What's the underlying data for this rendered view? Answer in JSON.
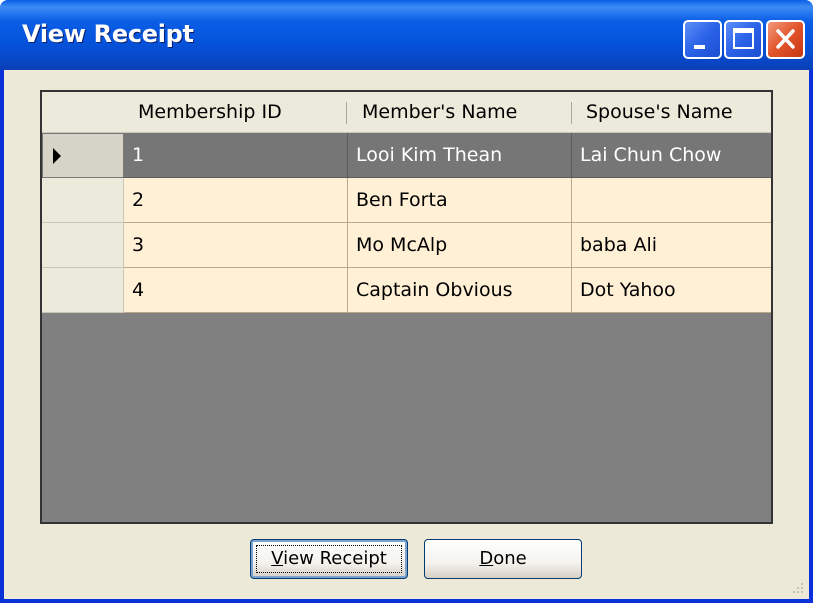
{
  "window": {
    "title": "View Receipt"
  },
  "grid": {
    "columns": [
      "Membership ID",
      "Member's Name",
      "Spouse's Name"
    ],
    "rows": [
      [
        "1",
        "Looi Kim Thean",
        "Lai Chun Chow"
      ],
      [
        "2",
        "Ben Forta",
        ""
      ],
      [
        "3",
        "Mo McAlp",
        "baba Ali"
      ],
      [
        "4",
        "Captain Obvious",
        "Dot Yahoo"
      ]
    ],
    "selected_row": 0
  },
  "buttons": {
    "view_receipt": {
      "accel": "V",
      "rest": "iew Receipt"
    },
    "done": {
      "accel": "D",
      "rest": "one"
    }
  },
  "colors": {
    "row_bg": "#fff0d6",
    "selected_bg": "#767676",
    "grid_empty_bg": "#808080",
    "titlebar": "#0553dc"
  }
}
